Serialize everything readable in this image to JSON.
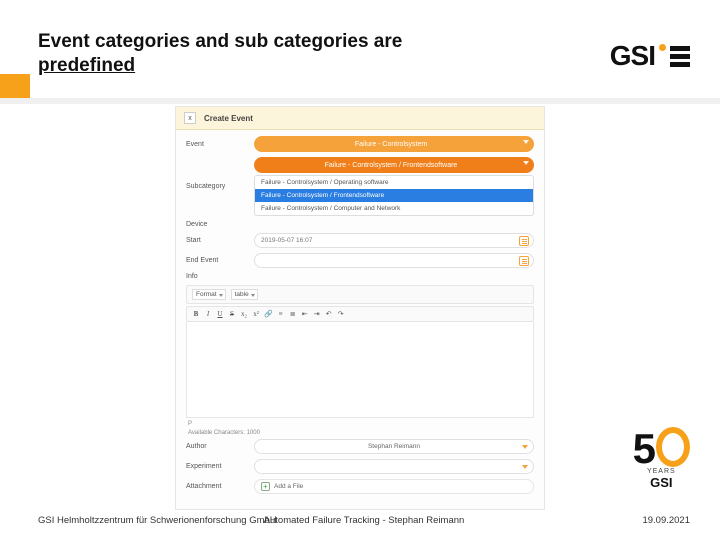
{
  "slide": {
    "title_line1": "Event categories and sub categories are",
    "title_line2": "predefined"
  },
  "logo": {
    "text": "GSI"
  },
  "anniversary": {
    "years_label": "YEARS",
    "brand": "GSI",
    "number": "50"
  },
  "footer": {
    "left": "GSI Helmholtzzentrum für Schwerionenforschung GmbH",
    "center": "Automated Failure Tracking - Stephan Reimann",
    "right": "19.09.2021"
  },
  "form": {
    "header": {
      "close": "x",
      "title": "Create Event"
    },
    "labels": {
      "event": "Event",
      "subcategory": "Subcategory",
      "device": "Device",
      "start": "Start",
      "end": "End Event",
      "info": "Info",
      "author": "Author",
      "experiment": "Experiment",
      "attachment": "Attachment"
    },
    "event_value": "Failure - Controlsystem",
    "subcategory_value": "Failure - Controlsystem / Frontendsoftware",
    "subcategory_options": [
      "Failure - Controlsystem / Operating software",
      "Failure - Controlsystem / Frontendsoftware",
      "Failure - Controlsystem / Computer and Network"
    ],
    "start_value": "2019-05-07 16:07",
    "end_value": "",
    "editor": {
      "format_label": "Format",
      "table_label": "table",
      "toolbar_icons": [
        "B",
        "I",
        "U",
        "S",
        "x₂",
        "x²",
        "🔗",
        "≡",
        "≣",
        "⇤",
        "⇥",
        "↶",
        "↷"
      ],
      "status_left": "P",
      "status_right": "Available Characters: 1000"
    },
    "author_value": "Stephan Reimann",
    "experiment_value": "",
    "addfile_label": "Add a File"
  }
}
